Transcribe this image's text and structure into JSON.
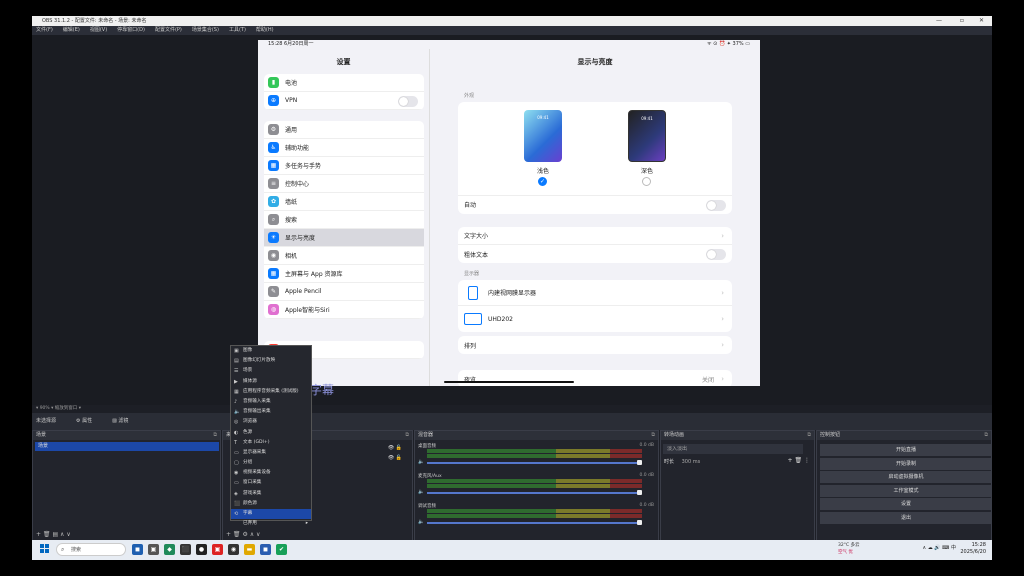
{
  "window": {
    "title": "OBS 31.1.2 - 配置文件: 未命名 - 场景: 未命名",
    "menu": [
      "文件(F)",
      "编辑(E)",
      "视图(V)",
      "停靠窗口(D)",
      "配置文件(P)",
      "场景集合(S)",
      "工具(T)",
      "帮助(H)"
    ]
  },
  "ipad": {
    "status_time": "15:28  6月20日周一",
    "status_right": "ᯤ ⊙ ⏰ ✦ 37% ▭",
    "sidebar_title": "设置",
    "sidebar_groups": [
      [
        {
          "label": "电池",
          "color": "#34c759",
          "icon": "▮"
        },
        {
          "label": "VPN",
          "color": "#0a7aff",
          "icon": "⊕",
          "toggle": true
        }
      ],
      [
        {
          "label": "通用",
          "color": "#8e8e93",
          "icon": "⚙"
        },
        {
          "label": "辅助功能",
          "color": "#0a7aff",
          "icon": "♿"
        },
        {
          "label": "多任务与手势",
          "color": "#0a7aff",
          "icon": "▦"
        },
        {
          "label": "控制中心",
          "color": "#8e8e93",
          "icon": "≡"
        },
        {
          "label": "墙纸",
          "color": "#32ade6",
          "icon": "✿"
        },
        {
          "label": "搜索",
          "color": "#8e8e93",
          "icon": "⌕"
        },
        {
          "label": "显示与亮度",
          "color": "#0a7aff",
          "icon": "☀",
          "selected": true
        },
        {
          "label": "相机",
          "color": "#8e8e93",
          "icon": "◉"
        },
        {
          "label": "主屏幕与 App 资源库",
          "color": "#0a7aff",
          "icon": "▦"
        },
        {
          "label": "Apple Pencil",
          "color": "#8e8e93",
          "icon": "✎"
        },
        {
          "label": "Apple智能与Siri",
          "color": "#e070d0",
          "icon": "◍"
        }
      ],
      [
        {
          "label": "通知",
          "color": "#ff3b30",
          "icon": "◼"
        }
      ]
    ],
    "detail_title": "显示与亮度",
    "appearance_label": "外观",
    "modes": [
      {
        "label": "浅色",
        "phone_text": "09:41",
        "selected": true
      },
      {
        "label": "深色",
        "phone_text": "09:41",
        "selected": false
      }
    ],
    "auto_label": "自动",
    "text_rows": [
      {
        "label": "文字大小",
        "type": "chev"
      },
      {
        "label": "粗体文本",
        "type": "toggle"
      }
    ],
    "displays_label": "显示器",
    "displays": [
      {
        "label": "内建视网膜显示器",
        "icon": "tablet-icon"
      },
      {
        "label": "UHD202",
        "icon": "monitor-icon"
      }
    ],
    "arrange_label": "排列",
    "night_label": "夜览",
    "night_value": "关闭"
  },
  "subtitle_text": "字幕",
  "context_menu": {
    "items": [
      {
        "label": "图像",
        "icon": "▣"
      },
      {
        "label": "图像幻灯片放映",
        "icon": "▤"
      },
      {
        "label": "场景",
        "icon": "☰"
      },
      {
        "label": "媒体源",
        "icon": "▶"
      },
      {
        "label": "应用程序音频采集 (测试版)",
        "icon": "▦"
      },
      {
        "label": "音频输入采集",
        "icon": "♪"
      },
      {
        "label": "音频输出采集",
        "icon": "🔈"
      },
      {
        "label": "浏览器",
        "icon": "◎"
      },
      {
        "label": "色源",
        "icon": "◐"
      },
      {
        "label": "文本 (GDI+)",
        "icon": "T"
      },
      {
        "label": "显示器采集",
        "icon": "▭"
      },
      {
        "label": "分组",
        "icon": "▢"
      },
      {
        "label": "视频采集设备",
        "icon": "◉"
      },
      {
        "label": "窗口采集",
        "icon": "▭"
      },
      {
        "label": "游戏采集",
        "icon": "◈"
      },
      {
        "label": "颜色源",
        "icon": "⬛"
      },
      {
        "label": "字幕",
        "icon": "⟲",
        "active": true
      },
      {
        "label": "已弃用",
        "icon": "",
        "submenu": true
      }
    ]
  },
  "toolstrip": "▾  90%  ▾  缩放到窗口  ▾",
  "scene_bar": {
    "items": [
      "未选择源",
      "⚙ 属性",
      "▨ 滤镜"
    ]
  },
  "docks": {
    "scenes": {
      "title": "场景",
      "selected": "场景",
      "footer": "+ 🗑 ▤ ∧ ∨"
    },
    "sources": {
      "title": "来源",
      "footer": "+ 🗑 ⚙ ∧ ∨"
    },
    "mixer": {
      "title": "混音器",
      "rows": [
        {
          "name": "桌面音频",
          "db": "0.0 dB",
          "level": 0.62
        },
        {
          "name": "麦克风/Aux",
          "db": "0.0 dB",
          "level": 0.62
        },
        {
          "name": "调试音频",
          "db": "0.0 dB",
          "level": 0.62
        }
      ],
      "ticks": [
        "-60",
        "-55",
        "-50",
        "-45",
        "-40",
        "-35",
        "-30",
        "-25",
        "-20",
        "-15",
        "-10",
        "-5",
        "0"
      ]
    },
    "transitions": {
      "title": "转场动画",
      "type": "淡入淡出",
      "duration_label": "时长",
      "duration_value": "300 ms"
    },
    "controls": {
      "title": "控制按钮",
      "buttons": [
        "开始直播",
        "开始录制",
        "启动虚拟摄像机",
        "工作室模式",
        "设置",
        "退出"
      ]
    }
  },
  "statusbar": "●  00:00:00    ●  00:00:00    CPU: 1.1%    60.00 / 60.00 FPS",
  "taskbar": {
    "search_placeholder": "搜索",
    "apps": [
      {
        "icon": "◼",
        "color": "#1e5fb0"
      },
      {
        "icon": "▣",
        "color": "#555"
      },
      {
        "icon": "◆",
        "color": "#1f8a5a"
      },
      {
        "icon": "⬛",
        "color": "#333"
      },
      {
        "icon": "●",
        "color": "#222"
      },
      {
        "icon": "▣",
        "color": "#d22"
      },
      {
        "icon": "◉",
        "color": "#333"
      },
      {
        "icon": "▬",
        "color": "#e0a800"
      },
      {
        "icon": "◼",
        "color": "#2a5db0"
      },
      {
        "icon": "✔",
        "color": "#18a058"
      }
    ],
    "weather_temp": "32°C 多云",
    "weather_sub": "空气 优",
    "tray": "∧  ☁  🔊  ⌨  中",
    "time": "15:28",
    "date": "2025/6/20"
  },
  "colors": {
    "accent": "#1c48a8",
    "ios_blue": "#0a7aff"
  }
}
